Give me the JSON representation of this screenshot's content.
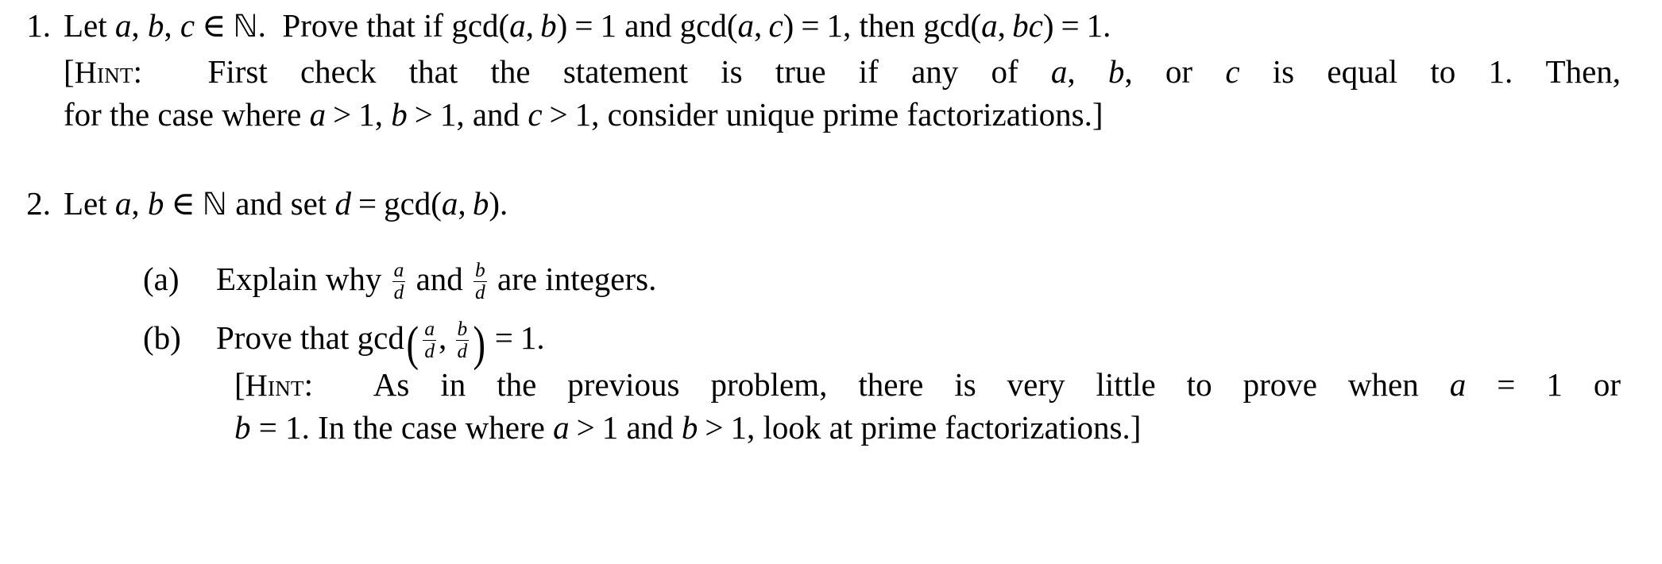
{
  "document": {
    "type": "math-problem-set",
    "background_color": "#ffffff",
    "text_color": "#000000"
  },
  "problems": [
    {
      "marker": "1.",
      "statement": {
        "text": "Let a, b, c ∈ ℕ. Prove that if gcd(a, b) = 1 and gcd(a, c) = 1, then gcd(a, bc) = 1.",
        "parts": {
          "let": "Let",
          "var_a": "a",
          "comma1": ",",
          "var_b": "b",
          "comma2": ",",
          "var_c": "c",
          "member": "∈",
          "naturals": "ℕ",
          "period1": ".",
          "prove_if": "Prove that if",
          "gcd": "gcd",
          "open_paren": "(",
          "close_paren": ")",
          "equals": "=",
          "one": "1",
          "and": "and",
          "comma3": ",",
          "then": "then",
          "var_bc": "bc",
          "period2": "."
        }
      },
      "hint": {
        "label": "Hint",
        "colon": ":",
        "open_bracket": "[",
        "close_bracket": "]",
        "line1_a": "First check that the statement is true if any of",
        "line1_b": "is equal to 1.",
        "line1_c": "Then,",
        "or": "or",
        "line2_a": "for the case where",
        "line2_b": "consider unique prime factorizations.",
        "gt": ">",
        "one": "1",
        "and": "and",
        "var_a": "a",
        "var_b": "b",
        "var_c": "c"
      }
    },
    {
      "marker": "2.",
      "statement": {
        "text": "Let a, b ∈ ℕ and set d = gcd(a, b).",
        "parts": {
          "let": "Let",
          "var_a": "a",
          "comma1": ",",
          "var_b": "b",
          "member": "∈",
          "naturals": "ℕ",
          "and_set": "and set",
          "var_d": "d",
          "equals": "=",
          "gcd": "gcd",
          "open_paren": "(",
          "close_paren": ")",
          "period": "."
        }
      },
      "subitems": [
        {
          "marker": "(a)",
          "text": "Explain why a/d and b/d are integers.",
          "parts": {
            "explain_why": "Explain why",
            "num_a": "a",
            "den_d": "d",
            "and": "and",
            "num_b": "b",
            "are_integers": "are integers."
          }
        },
        {
          "marker": "(b)",
          "text": "Prove that gcd(a/d, b/d) = 1.",
          "parts": {
            "prove_that": "Prove that",
            "gcd": "gcd",
            "open_paren": "(",
            "close_paren": ")",
            "num_a": "a",
            "den_d": "d",
            "comma": ",",
            "num_b": "b",
            "equals": "=",
            "one": "1",
            "period": "."
          },
          "hint": {
            "label": "Hint",
            "colon": ":",
            "open_bracket": "[",
            "close_bracket": "]",
            "line1_a": "As in the previous problem, there is very little to prove when",
            "line1_b": "= 1 or",
            "line2_a": "= 1.",
            "line2_b": "In the case where",
            "line2_c": "look at prime factorizations.",
            "var_a": "a",
            "var_b": "b",
            "equals": "=",
            "gt": ">",
            "one": "1",
            "and": "and"
          }
        }
      ]
    }
  ]
}
